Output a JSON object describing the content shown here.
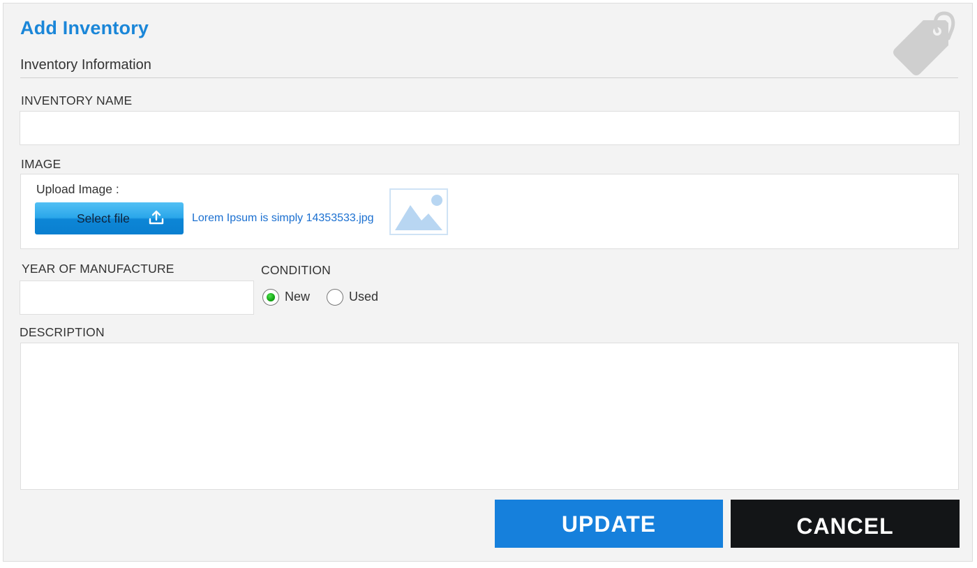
{
  "header": {
    "title": "Add Inventory",
    "section": "Inventory Information",
    "icon": "tag-icon"
  },
  "form": {
    "inventory_name": {
      "label": "INVENTORY NAME",
      "value": ""
    },
    "image": {
      "label": "IMAGE",
      "upload_label": "Upload Image :",
      "button_label": "Select file",
      "button_icon": "upload-icon",
      "file_name": "Lorem Ipsum is simply 14353533.jpg",
      "preview_icon": "image-placeholder-icon"
    },
    "year": {
      "label": "YEAR OF MANUFACTURE",
      "value": ""
    },
    "condition": {
      "label": "CONDITION",
      "options": [
        {
          "label": "New",
          "selected": true
        },
        {
          "label": "Used",
          "selected": false
        }
      ]
    },
    "description": {
      "label": "DESCRIPTION",
      "value": ""
    }
  },
  "actions": {
    "update_label": "UPDATE",
    "cancel_label": "CANCEL"
  },
  "colors": {
    "accent": "#1a86d8",
    "update_button": "#1680dc",
    "cancel_button": "#131517",
    "radio_selected": "#12a512"
  }
}
